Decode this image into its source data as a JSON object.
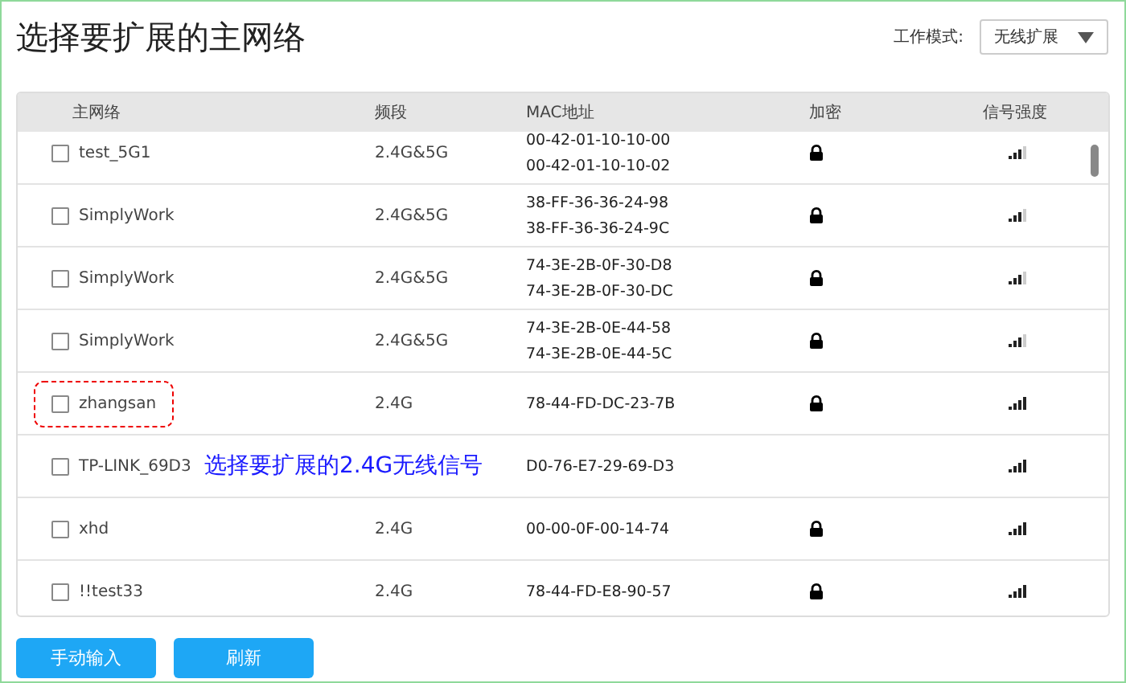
{
  "title": "选择要扩展的主网络",
  "mode": {
    "label": "工作模式:",
    "value": "无线扩展"
  },
  "table": {
    "columns": [
      "主网络",
      "频段",
      "MAC地址",
      "加密",
      "信号强度"
    ],
    "rows": [
      {
        "name": "test_5G1",
        "band": "2.4G&5G",
        "macs": [
          "00-42-01-10-10-00",
          "00-42-01-10-10-02"
        ],
        "checked": false,
        "encrypted": true,
        "signal_full": false,
        "highlighted": false
      },
      {
        "name": "SimplyWork",
        "band": "2.4G&5G",
        "macs": [
          "38-FF-36-36-24-98",
          "38-FF-36-36-24-9C"
        ],
        "checked": false,
        "encrypted": true,
        "signal_full": false,
        "highlighted": false
      },
      {
        "name": "SimplyWork",
        "band": "2.4G&5G",
        "macs": [
          "74-3E-2B-0F-30-D8",
          "74-3E-2B-0F-30-DC"
        ],
        "checked": false,
        "encrypted": true,
        "signal_full": false,
        "highlighted": false
      },
      {
        "name": "SimplyWork",
        "band": "2.4G&5G",
        "macs": [
          "74-3E-2B-0E-44-58",
          "74-3E-2B-0E-44-5C"
        ],
        "checked": false,
        "encrypted": true,
        "signal_full": false,
        "highlighted": false
      },
      {
        "name": "zhangsan",
        "band": "2.4G",
        "macs": [
          "78-44-FD-DC-23-7B"
        ],
        "checked": false,
        "encrypted": true,
        "signal_full": true,
        "highlighted": true
      },
      {
        "name": "TP-LINK_69D3",
        "macs": [
          "D0-76-E7-29-69-D3"
        ],
        "checked": false,
        "encrypted": false,
        "signal_full": true,
        "highlighted": false
      },
      {
        "name": "xhd",
        "band": "2.4G",
        "macs": [
          "00-00-0F-00-14-74"
        ],
        "checked": false,
        "encrypted": true,
        "signal_full": true,
        "highlighted": false
      },
      {
        "name": "!!test33",
        "band": "2.4G",
        "macs": [
          "78-44-FD-E8-90-57"
        ],
        "checked": false,
        "encrypted": true,
        "signal_full": true,
        "highlighted": false
      }
    ]
  },
  "annotation": "选择要扩展的2.4G无线信号",
  "buttons": [
    "手动输入",
    "刷新"
  ]
}
